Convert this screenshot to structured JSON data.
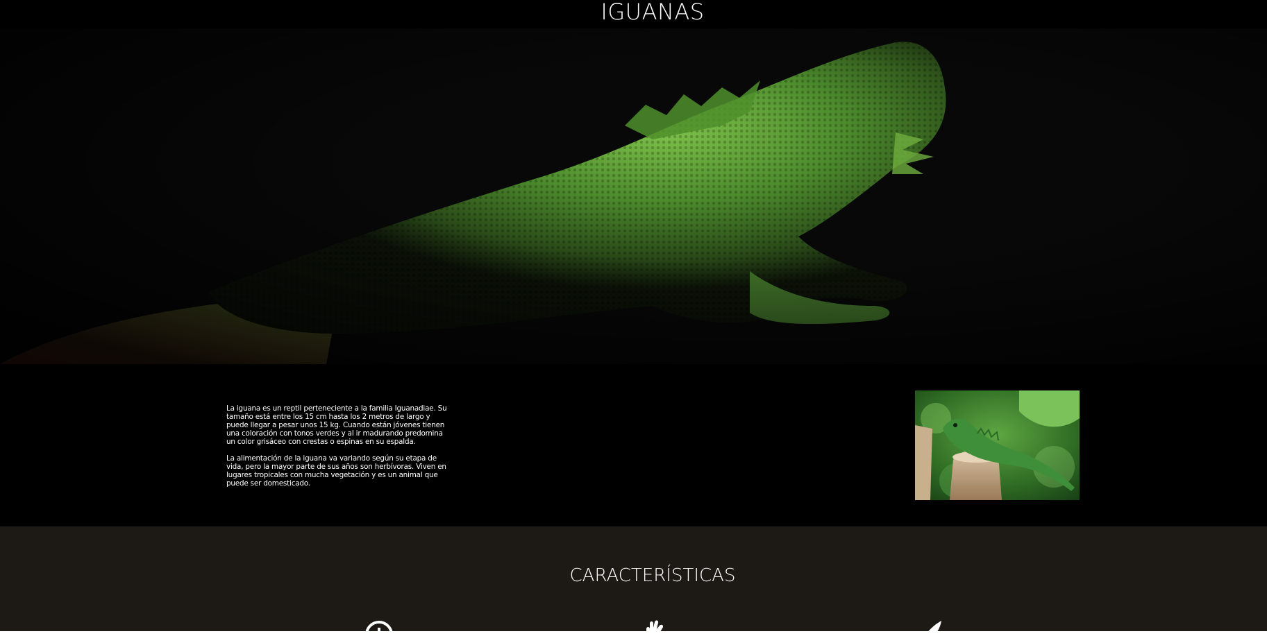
{
  "header": {
    "title": "IGUANAS"
  },
  "intro": {
    "paragraphs": [
      "La iguana es un reptil perteneciente a la familia Iguanadiae. Su tamaño está entre los 15 cm hasta los 2 metros de largo y puede llegar a pesar unos 15 kg. Cuando están jóvenes tienen una coloración con tonos verdes y al ir madurando predomina un color grisáceo con crestas o espinas en su espalda.",
      "La alimentación de la iguana va variando según su etapa de vida, pero la mayor parte de sus años son herbívoras. Viven en lugares tropicales con mucha vegetación y es un animal que puede ser domesticado."
    ]
  },
  "features": {
    "title": "CARACTERÍSTICAS",
    "icons": [
      "clock-icon",
      "hand-icon",
      "leaf-icon"
    ]
  },
  "colors": {
    "header_bg": "#000000",
    "features_bg": "#1d1915",
    "text": "#ffffff",
    "lizard_green": "#5fa83a"
  }
}
